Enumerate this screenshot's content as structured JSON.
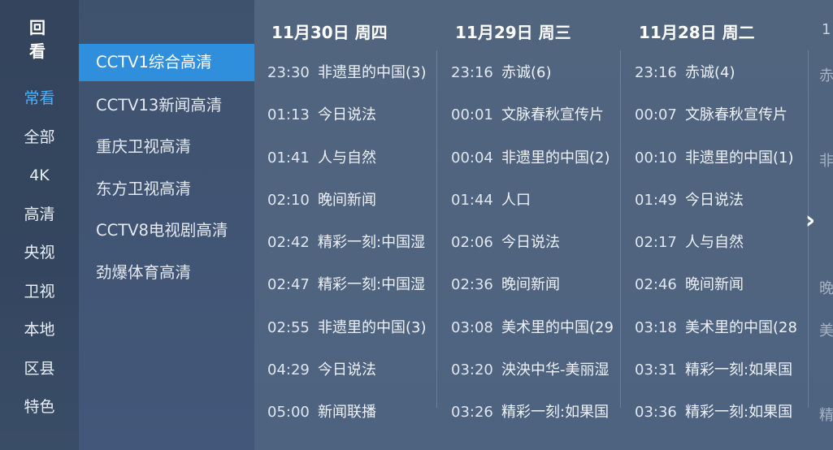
{
  "title": "回 看",
  "categories": [
    "常看",
    "全部",
    "4K",
    "高清",
    "央视",
    "卫视",
    "本地",
    "区县",
    "特色"
  ],
  "active_category": 0,
  "channels": [
    "CCTV1综合高清",
    "CCTV13新闻高清",
    "重庆卫视高清",
    "东方卫视高清",
    "CCTV8电视剧高清",
    "劲爆体育高清"
  ],
  "selected_channel": 0,
  "days": [
    {
      "header": "11月30日  周四",
      "programs": [
        {
          "time": "23:30",
          "name": "非遗里的中国(3)"
        },
        {
          "time": "01:13",
          "name": "今日说法"
        },
        {
          "time": "01:41",
          "name": "人与自然"
        },
        {
          "time": "02:10",
          "name": "晚间新闻"
        },
        {
          "time": "02:42",
          "name": "精彩一刻:中国湿"
        },
        {
          "time": "02:47",
          "name": "精彩一刻:中国湿"
        },
        {
          "time": "02:55",
          "name": "非遗里的中国(3)"
        },
        {
          "time": "04:29",
          "name": "今日说法"
        },
        {
          "time": "05:00",
          "name": "新闻联播"
        }
      ]
    },
    {
      "header": "11月29日  周三",
      "programs": [
        {
          "time": "23:16",
          "name": "赤诚(6)"
        },
        {
          "time": "00:01",
          "name": "文脉春秋宣传片"
        },
        {
          "time": "00:04",
          "name": "非遗里的中国(2)"
        },
        {
          "time": "01:44",
          "name": "人口"
        },
        {
          "time": "02:06",
          "name": "今日说法"
        },
        {
          "time": "02:36",
          "name": "晚间新闻"
        },
        {
          "time": "03:08",
          "name": "美术里的中国(29"
        },
        {
          "time": "03:20",
          "name": "泱泱中华-美丽湿"
        },
        {
          "time": "03:26",
          "name": "精彩一刻:如果国"
        }
      ]
    },
    {
      "header": "11月28日  周二",
      "programs": [
        {
          "time": "23:16",
          "name": "赤诚(4)"
        },
        {
          "time": "00:07",
          "name": "文脉春秋宣传片"
        },
        {
          "time": "00:10",
          "name": "非遗里的中国(1)"
        },
        {
          "time": "01:49",
          "name": "今日说法"
        },
        {
          "time": "02:17",
          "name": "人与自然"
        },
        {
          "time": "02:46",
          "name": "晚间新闻"
        },
        {
          "time": "03:18",
          "name": "美术里的中国(28"
        },
        {
          "time": "03:31",
          "name": "精彩一刻:如果国"
        },
        {
          "time": "03:36",
          "name": "精彩一刻:如果国"
        }
      ]
    }
  ],
  "partial_next_day": {
    "header": "1",
    "names": [
      "赤",
      "",
      "非",
      "",
      "",
      "晚",
      "美",
      "",
      "精"
    ]
  },
  "next_icon": "chevron-right-icon",
  "colors": {
    "accent": "#2f8fdc",
    "active_text": "#4fb0ff"
  }
}
